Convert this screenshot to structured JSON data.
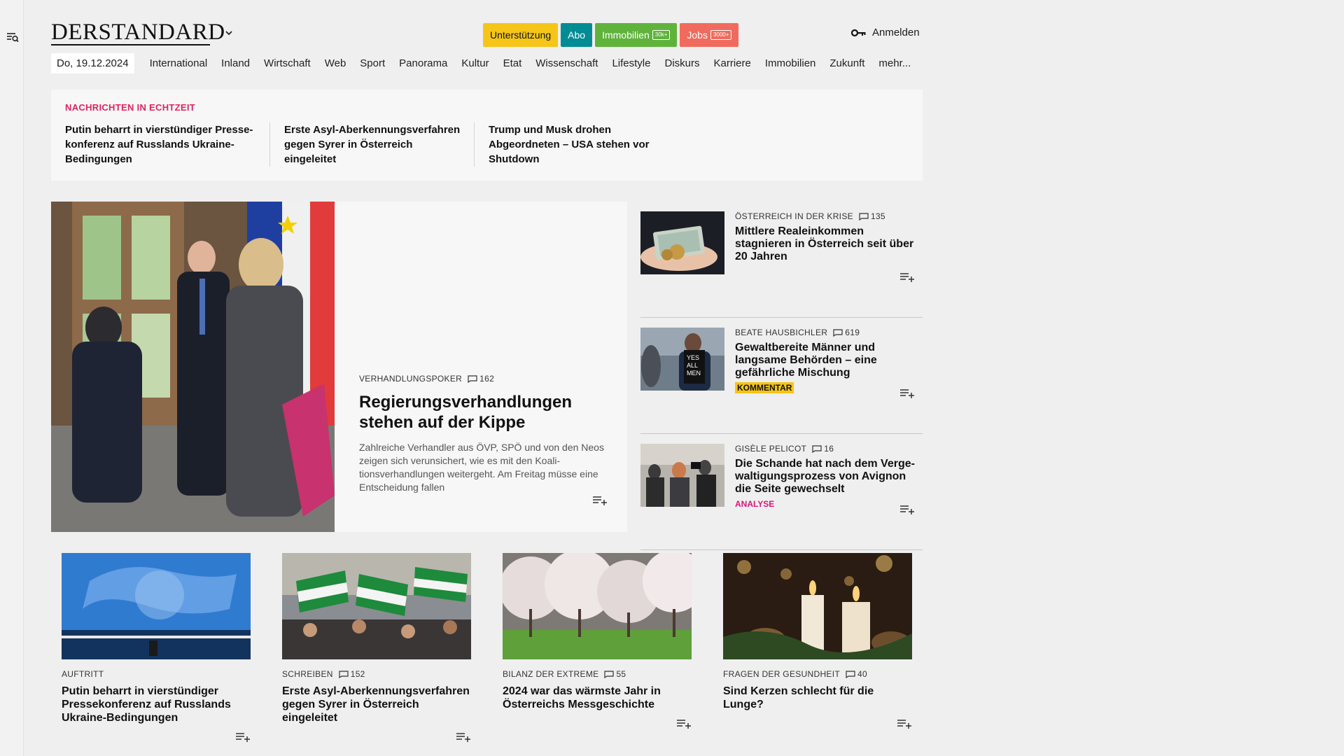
{
  "header": {
    "logo": "DERSTANDARD",
    "pills": [
      {
        "label": "Unterstützung",
        "bg": "#f5c518",
        "fg": "#111111",
        "badge": ""
      },
      {
        "label": "Abo",
        "bg": "#008c95",
        "fg": "#ffffff",
        "badge": ""
      },
      {
        "label": "Immobilien",
        "bg": "#5fb33b",
        "fg": "#ffffff",
        "badge": "30k+"
      },
      {
        "label": "Jobs",
        "bg": "#f06b5d",
        "fg": "#ffffff",
        "badge": "3000+"
      }
    ],
    "login_label": "Anmelden"
  },
  "nav": {
    "date": "Do, 19.12.2024",
    "items": [
      "International",
      "Inland",
      "Wirtschaft",
      "Web",
      "Sport",
      "Panorama",
      "Kultur",
      "Etat",
      "Wissenschaft",
      "Lifestyle",
      "Diskurs",
      "Karriere",
      "Immobilien",
      "Zukunft",
      "mehr..."
    ]
  },
  "live": {
    "label": "NACHRICHTEN IN ECHTZEIT",
    "items": [
      "Putin beharrt in vierstündiger Presse­konferenz auf Russlands Ukraine-Bedingungen",
      "Erste Asyl-Aberkennungsverfahren gegen Syrer in Österreich eingeleitet",
      "Trump und Musk drohen Abgeordne­ten – USA stehen vor Shutdown"
    ]
  },
  "hero": {
    "kicker": "VERHANDLUNGSPOKER",
    "comments": "162",
    "title": "Regierungsverhandlungen stehen auf der Kippe",
    "teaser": "Zahlreiche Verhandler aus ÖVP, SPÖ und von den Neos zeigen sich verunsichert, wie es mit den Koali­tionsverhandlungen weitergeht. Am Freitag müsse eine Entscheidung fallen"
  },
  "side": [
    {
      "kicker": "ÖSTERREICH IN DER KRISE",
      "comments": "135",
      "title": "Mittlere Realeinkommen stagnieren in Österreich seit über 20 Jahren",
      "tag": "",
      "tag_style": "none"
    },
    {
      "kicker": "BEATE HAUSBICHLER",
      "comments": "619",
      "title": "Gewaltbereite Männer und langsame Behörden – eine gefährliche Mischung",
      "tag": "KOMMENTAR",
      "tag_style": "yellow"
    },
    {
      "kicker": "GISÈLE PELICOT",
      "comments": "16",
      "title": "Die Schande hat nach dem Verge­waltigungsprozess von Avignon die Seite gewechselt",
      "tag": "ANALYSE",
      "tag_style": "pink"
    }
  ],
  "cards": [
    {
      "kicker": "AUFTRITT",
      "comments": "",
      "title": "Putin beharrt in vierstündiger Pressekonferenz auf Russlands Ukraine-Bedingungen"
    },
    {
      "kicker": "SCHREIBEN",
      "comments": "152",
      "title": "Erste Asyl-Aberkennungsverfah­ren gegen Syrer in Österreich eingeleitet"
    },
    {
      "kicker": "BILANZ DER EXTREME",
      "comments": "55",
      "title": "2024 war das wärmste Jahr in Österreichs Messgeschichte"
    },
    {
      "kicker": "FRAGEN DER GESUNDHEIT",
      "comments": "40",
      "title": "Sind Kerzen schlecht für die Lunge?"
    }
  ],
  "icons": {
    "rail": "search-menu-icon",
    "chevron": "chevron-down-icon",
    "login": "key-icon",
    "comment": "comment-icon",
    "addlist": "add-to-list-icon"
  }
}
